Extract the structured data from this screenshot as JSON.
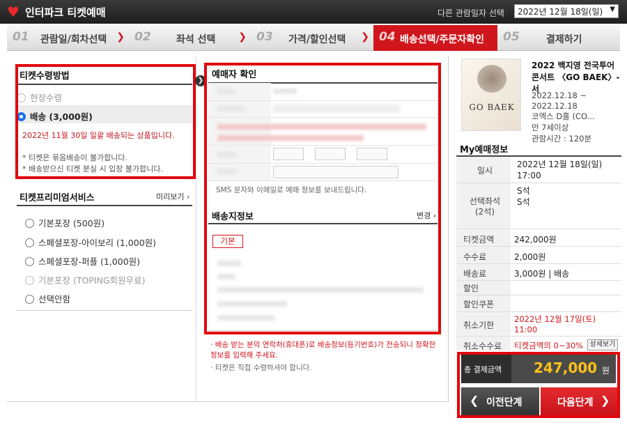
{
  "header": {
    "logo_text": "인터파크 티켓예매",
    "date_label": "다른 관람일자 선택",
    "date_value": "2022년 12월 18일(일)"
  },
  "steps": [
    {
      "num": "01",
      "label": "관람일/회차선택"
    },
    {
      "num": "02",
      "label": "좌석 선택"
    },
    {
      "num": "03",
      "label": "가격/할인선택"
    },
    {
      "num": "04",
      "label": "배송선택/주문자확인"
    },
    {
      "num": "05",
      "label": "결제하기"
    }
  ],
  "receive": {
    "title": "티켓수령방법",
    "options": [
      "현장수령",
      "배송 (3,000원)"
    ],
    "notice": "2022년 11월 30일 일괄 배송되는 상품입니다.",
    "notes": [
      "* 티켓은 묶음배송이 불가합니다.",
      "* 배송받으신 티켓 분실 시 입장 불가합니다."
    ]
  },
  "premium": {
    "title": "티켓프리미엄서비스",
    "preview": "미리보기",
    "options": [
      "기본포장 (500원)",
      "스페셜포장-아이보리 (1,000원)",
      "스페셜포장-퍼플 (1,000원)",
      "기본포장 (TOPING회원무료)",
      "선택안함"
    ]
  },
  "booker": {
    "title": "예매자 확인",
    "sms_note": "SMS 문자와 이메일로 예매 정보를 보내드립니다."
  },
  "delivery": {
    "title": "배송지정보",
    "change": "변경",
    "tag": "기본"
  },
  "mid_notes": [
    "배송 받는 분의 연락처(휴대폰)로 배송정보(등기번호)가 전송되니 정확한 정보를 입력해 주세요.",
    "티켓은 직접 수령하셔야 합니다."
  ],
  "show": {
    "title": "2022 백지영 전국투어 콘서트 〈GO BAEK〉-서",
    "poster_text": "GO BAEK",
    "dates": "2022.12.18 ~\n2022.12.18",
    "venue": "코엑스 D홀 (CO...",
    "age": "만 7세이상",
    "runtime": "관람시간 : 120분"
  },
  "my": {
    "title": "My예매정보",
    "rows": [
      {
        "label": "일시",
        "value": "2022년 12월 18일(일)\n17:00"
      },
      {
        "label": "선택좌석\n(2석)",
        "value": "S석\nS석"
      },
      {
        "label": "티켓금액",
        "value": "242,000원"
      },
      {
        "label": "수수료",
        "value": "2,000원"
      },
      {
        "label": "배송료",
        "value": "3,000원 | 배송"
      },
      {
        "label": "할인",
        "value": ""
      },
      {
        "label": "할인쿠폰",
        "value": ""
      },
      {
        "label": "취소기한",
        "value": "2022년 12월 17일(토)\n11:00"
      },
      {
        "label": "취소수수료",
        "value": "티켓금액의 0~30%"
      }
    ],
    "detail_btn": "상세보기",
    "total_label": "총 결제금액",
    "total_value": "247,000",
    "total_unit": "원"
  },
  "buttons": {
    "prev": "이전단계",
    "next": "다음단계"
  },
  "colors": {
    "accent": "#d0161c",
    "highlight_box": "#e1060d",
    "total_value": "#ffc21a"
  }
}
